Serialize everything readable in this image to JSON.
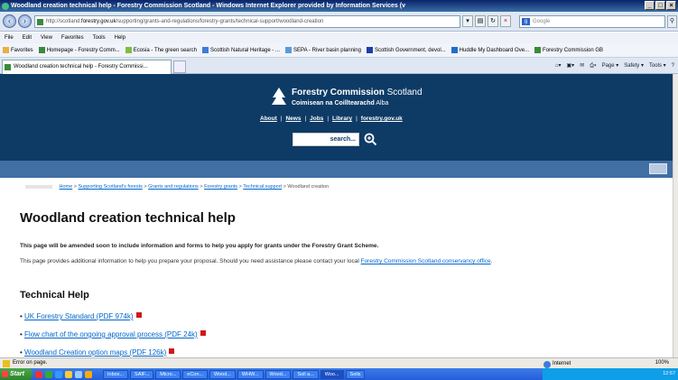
{
  "window": {
    "title": "Woodland creation technical help - Forestry Commission Scotland - Windows Internet Explorer provided by Information Services (v"
  },
  "address": {
    "prefix": "http://scotland.",
    "domain": "forestry.gov.uk",
    "path": "/supporting/grants-and-regulations/forestry-grants/technical-support/woodland-creation"
  },
  "search_box": {
    "placeholder": "Google",
    "logo": "g"
  },
  "menu": [
    "File",
    "Edit",
    "View",
    "Favorites",
    "Tools",
    "Help"
  ],
  "favorites": [
    "Favorites",
    "Homepage - Forestry Comm...",
    "Ecosia - The green search",
    "Scottish Natural Heritage - ...",
    "SEPA - River basin planning",
    "Scottish Government, devol...",
    "Huddle My Dashboard Ove...",
    "Forestry Commission GB"
  ],
  "tab": {
    "label": "Woodland creation technical help - Forestry Commissi..."
  },
  "command_bar": [
    "Page ▾",
    "Safety ▾",
    "Tools ▾"
  ],
  "site": {
    "name": "Forestry Commission",
    "name_region": "Scotland",
    "gaelic": "Coimisean na Coilltearachd",
    "gaelic_region": "Alba",
    "nav": [
      "About",
      "News",
      "Jobs",
      "Library",
      "forestry.gov.uk"
    ],
    "search_value": "search..."
  },
  "breadcrumbs": {
    "items": [
      "Home",
      "Supporting Scotland's forests",
      "Grants and regulations",
      "Forestry grants",
      "Technical support"
    ],
    "current": "Woodland creation",
    "sep": ">"
  },
  "page": {
    "title": "Woodland creation technical help",
    "notice": "This page will be amended soon to include information and forms to help you apply for grants under the Forestry Grant Scheme.",
    "info_text": "This page provides additional information to help you prepare your proposal. Should you need assistance please contact your local ",
    "info_link": "Forestry Commission Scotland conservancy office",
    "info_end": ".",
    "section_title": "Technical Help",
    "links": [
      "UK Forestry Standard (PDF 974k)",
      "Flow chart of the ongoing approval process (PDF 24k)",
      "Woodland Creation option maps (PDF 126k)"
    ]
  },
  "status": {
    "text": "Error on page.",
    "zone": "Internet",
    "zoom": "100%"
  },
  "taskbar": {
    "start": "Start",
    "tasks": [
      "Inbox...",
      "SAIF...",
      "Micro...",
      "eCon...",
      "Wood...",
      "WHW...",
      "Wood...",
      "Soil a...",
      "Woo...",
      "Soils"
    ],
    "clock": "12:57"
  }
}
